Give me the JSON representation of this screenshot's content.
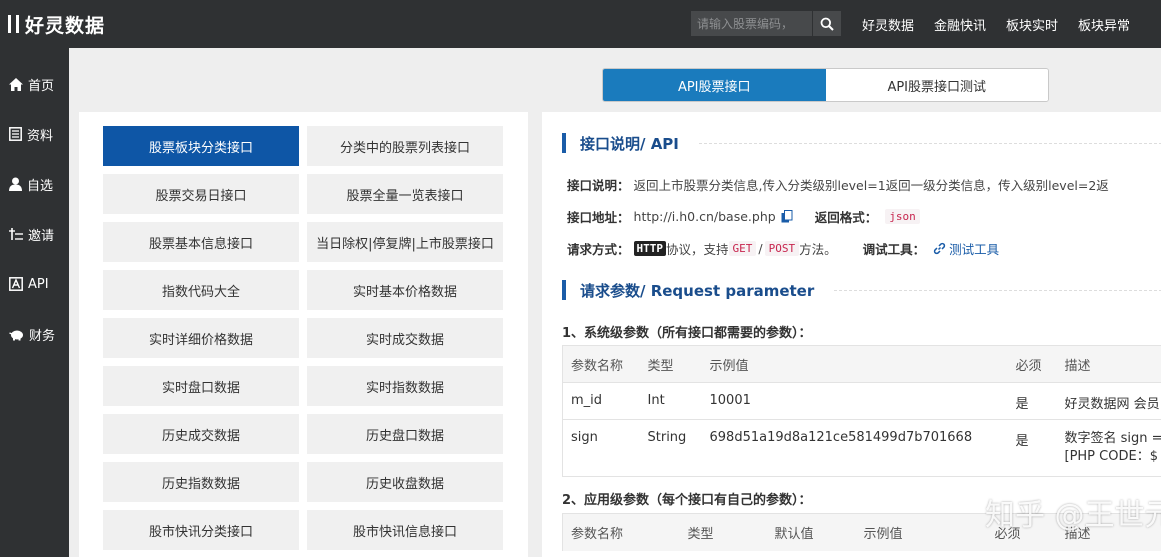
{
  "header": {
    "logo_text": "好灵数据",
    "search_placeholder": "请输入股票编码，",
    "nav": [
      "好灵数据",
      "金融快讯",
      "板块实时",
      "板块异常"
    ]
  },
  "sidebar": {
    "items": [
      {
        "label": "首页",
        "icon": "home-icon"
      },
      {
        "label": "资料",
        "icon": "document-icon"
      },
      {
        "label": "自选",
        "icon": "user-icon"
      },
      {
        "label": "邀请",
        "icon": "invite-icon"
      },
      {
        "label": "API",
        "icon": "api-icon"
      },
      {
        "label": "财务",
        "icon": "piggy-bank-icon"
      }
    ]
  },
  "tabs": [
    "API股票接口",
    "API股票接口测试"
  ],
  "api_list": [
    "股票板块分类接口",
    "分类中的股票列表接口",
    "股票交易日接口",
    "股票全量一览表接口",
    "股票基本信息接口",
    "当日除权|停复牌|上市股票接口",
    "指数代码大全",
    "实时基本价格数据",
    "实时详细价格数据",
    "实时成交数据",
    "实时盘口数据",
    "实时指数数据",
    "历史成交数据",
    "历史盘口数据",
    "历史指数数据",
    "历史收盘数据",
    "股市快讯分类接口",
    "股市快讯信息接口"
  ],
  "detail": {
    "section1_title": "接口说明/ API",
    "desc_label": "接口说明：",
    "desc_text": "返回上市股票分类信息,传入分类级别level=1返回一级分类信息，传入级别level=2返",
    "addr_label": "接口地址：",
    "addr_value": "http://i.h0.cn/base.php",
    "format_label": "返回格式：",
    "format_value": "json",
    "method_label": "请求方式：",
    "method_http": "HTTP",
    "method_text1": "协议，支持",
    "method_get": "GET",
    "method_sep": "/",
    "method_post": "POST",
    "method_text2": "方法。",
    "debug_label": "调试工具：",
    "debug_link": "测试工具",
    "section2_title": "请求参数/ Request parameter",
    "sys_params_title": "1、系统级参数（所有接口都需要的参数）：",
    "sys_params_headers": [
      "参数名称",
      "类型",
      "示例值",
      "必须",
      "描述"
    ],
    "sys_params_rows": [
      {
        "name": "m_id",
        "type": "Int",
        "example": "10001",
        "required": "是",
        "desc": "好灵数据网 会员"
      },
      {
        "name": "sign",
        "type": "String",
        "example": "698d51a19d8a121ce581499d7b701668",
        "required": "是",
        "desc": "数字签名 sign =",
        "desc2": "[PHP CODE：$"
      }
    ],
    "app_params_title": "2、应用级参数（每个接口有自己的参数）：",
    "app_params_headers": [
      "参数名称",
      "类型",
      "默认值",
      "示例值",
      "必须",
      "描述"
    ]
  },
  "watermark": "知乎 @王世元"
}
